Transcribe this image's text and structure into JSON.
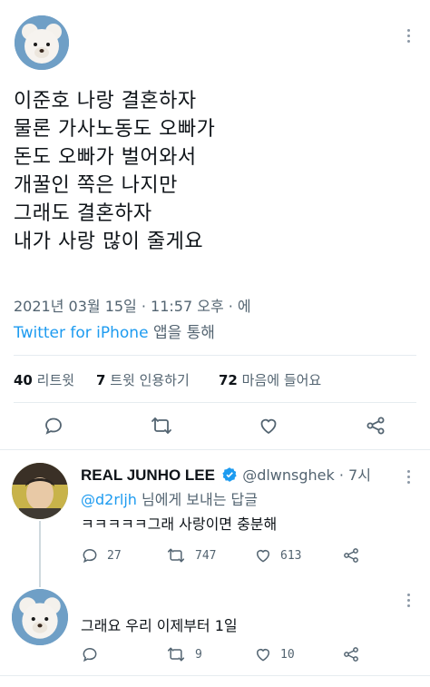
{
  "main": {
    "lines": [
      "이준호 나랑 결혼하자",
      "물론 가사노동도 오빠가",
      "돈도 오빠가 벌어와서",
      "개꿀인 쪽은 나지만",
      "그래도 결혼하자",
      "내가 사랑 많이 줄게요"
    ],
    "timestamp": "2021년 03월 15일 · 11:57 오후 · 에",
    "source_app": "Twitter for iPhone",
    "source_suffix": " 앱을 통해",
    "stats": {
      "retweets": "40",
      "retweets_label": "리트윗",
      "quotes": "7",
      "quotes_label": "트윗 인용하기",
      "likes": "72",
      "likes_label": "마음에 들어요"
    }
  },
  "reply": {
    "name": "REAL JUNHO LEE",
    "handle": "@dlwnsghek",
    "time": "· 7시",
    "replying_to": "@d2rljh",
    "replying_suffix": " 님에게 보내는 답글",
    "text": "ㅋㅋㅋㅋㅋ그래 사랑이면 충분해",
    "retweet_count": "747",
    "like_count": "613",
    "reply_count": "27"
  },
  "reply2": {
    "text": "그래요 우리 이제부터 1일",
    "retweet_count": "9",
    "like_count": "10"
  },
  "colors": {
    "accent": "#1d9bf0",
    "muted": "#536471",
    "divider": "#e6ecf0",
    "thread": "#cfd9de"
  }
}
